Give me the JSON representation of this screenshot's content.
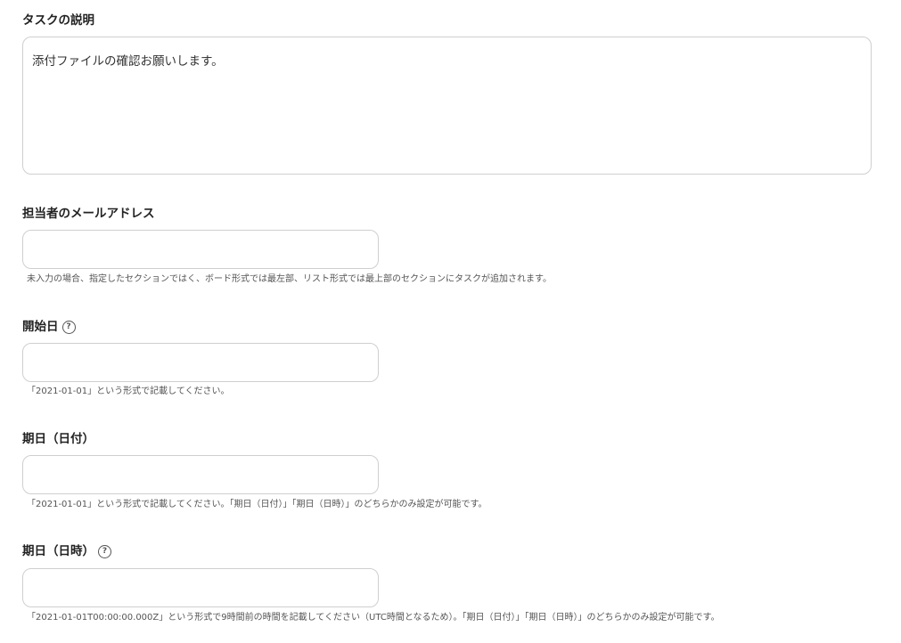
{
  "description": {
    "label": "タスクの説明",
    "value": "添付ファイルの確認お願いします。"
  },
  "assignee_email": {
    "label": "担当者のメールアドレス",
    "value": "",
    "hint": "未入力の場合、指定したセクションではく、ボード形式では最左部、リスト形式では最上部のセクションにタスクが追加されます。"
  },
  "start_date": {
    "label": "開始日",
    "help_icon": "question-circle-icon",
    "value": "",
    "hint": "「2021-01-01」という形式で記載してください。"
  },
  "due_date": {
    "label": "期日（日付）",
    "value": "",
    "hint": "「2021-01-01」という形式で記載してください。「期日（日付）」「期日（日時）」のどちらかのみ設定が可能です。"
  },
  "due_datetime": {
    "label": "期日（日時）",
    "help_icon": "question-circle-icon",
    "value": "",
    "hint": "「2021-01-01T00:00:00.000Z」という形式で9時間前の時間を記載してください（UTC時間となるため）。「期日（日付）」「期日（日時）」のどちらかのみ設定が可能です。"
  }
}
